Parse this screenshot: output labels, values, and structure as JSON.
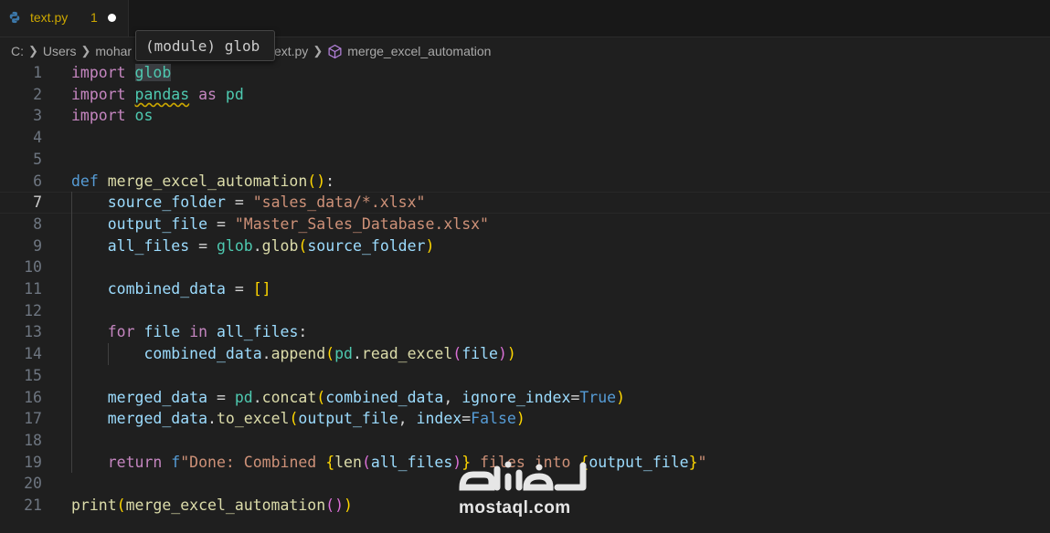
{
  "tab": {
    "filename": "text.py",
    "problem_count": "1"
  },
  "breadcrumb": {
    "drive": "C:",
    "users": "Users",
    "user": "mohar",
    "file": "text.py",
    "symbol": "merge_excel_automation"
  },
  "tooltip": {
    "text": "(module) glob"
  },
  "editor": {
    "current_line": 7
  },
  "watermark": {
    "text": "mostaql.com"
  },
  "colors": {
    "keyword": "#c586c0",
    "function": "#dcdcaa",
    "module": "#4ec9b0",
    "variable": "#9cdcfe",
    "string": "#ce9178",
    "warning": "#cca700"
  },
  "lines": [
    [
      [
        "kw",
        "import"
      ],
      [
        "txt",
        " "
      ],
      [
        "mod hl",
        "glob"
      ]
    ],
    [
      [
        "kw",
        "import"
      ],
      [
        "txt",
        " "
      ],
      [
        "mod squig",
        "pandas"
      ],
      [
        "txt",
        " "
      ],
      [
        "kw",
        "as"
      ],
      [
        "txt",
        " "
      ],
      [
        "mod",
        "pd"
      ]
    ],
    [
      [
        "kw",
        "import"
      ],
      [
        "txt",
        " "
      ],
      [
        "mod",
        "os"
      ]
    ],
    [],
    [],
    [
      [
        "def",
        "def"
      ],
      [
        "txt",
        " "
      ],
      [
        "fn",
        "merge_excel_automation"
      ],
      [
        "p1",
        "()"
      ],
      [
        "txt",
        ":"
      ]
    ],
    [
      [
        "txt",
        "    "
      ],
      [
        "var",
        "source_folder"
      ],
      [
        "txt",
        " = "
      ],
      [
        "str",
        "\"sales_data/*.xlsx\""
      ]
    ],
    [
      [
        "txt",
        "    "
      ],
      [
        "var",
        "output_file"
      ],
      [
        "txt",
        " = "
      ],
      [
        "str",
        "\"Master_Sales_Database.xlsx\""
      ]
    ],
    [
      [
        "txt",
        "    "
      ],
      [
        "var",
        "all_files"
      ],
      [
        "txt",
        " = "
      ],
      [
        "mod",
        "glob"
      ],
      [
        "txt",
        "."
      ],
      [
        "fn",
        "glob"
      ],
      [
        "p1",
        "("
      ],
      [
        "var",
        "source_folder"
      ],
      [
        "p1",
        ")"
      ]
    ],
    [],
    [
      [
        "txt",
        "    "
      ],
      [
        "var",
        "combined_data"
      ],
      [
        "txt",
        " = "
      ],
      [
        "p1",
        "[]"
      ]
    ],
    [],
    [
      [
        "txt",
        "    "
      ],
      [
        "kw",
        "for"
      ],
      [
        "txt",
        " "
      ],
      [
        "var",
        "file"
      ],
      [
        "txt",
        " "
      ],
      [
        "kw",
        "in"
      ],
      [
        "txt",
        " "
      ],
      [
        "var",
        "all_files"
      ],
      [
        "txt",
        ":"
      ]
    ],
    [
      [
        "txt",
        "        "
      ],
      [
        "var",
        "combined_data"
      ],
      [
        "txt",
        "."
      ],
      [
        "fn",
        "append"
      ],
      [
        "p1",
        "("
      ],
      [
        "mod",
        "pd"
      ],
      [
        "txt",
        "."
      ],
      [
        "fn",
        "read_excel"
      ],
      [
        "p2",
        "("
      ],
      [
        "var",
        "file"
      ],
      [
        "p2",
        ")"
      ],
      [
        "p1",
        ")"
      ]
    ],
    [],
    [
      [
        "txt",
        "    "
      ],
      [
        "var",
        "merged_data"
      ],
      [
        "txt",
        " = "
      ],
      [
        "mod",
        "pd"
      ],
      [
        "txt",
        "."
      ],
      [
        "fn",
        "concat"
      ],
      [
        "p1",
        "("
      ],
      [
        "var",
        "combined_data"
      ],
      [
        "txt",
        ", "
      ],
      [
        "var",
        "ignore_index"
      ],
      [
        "txt",
        "="
      ],
      [
        "const",
        "True"
      ],
      [
        "p1",
        ")"
      ]
    ],
    [
      [
        "txt",
        "    "
      ],
      [
        "var",
        "merged_data"
      ],
      [
        "txt",
        "."
      ],
      [
        "fn",
        "to_excel"
      ],
      [
        "p1",
        "("
      ],
      [
        "var",
        "output_file"
      ],
      [
        "txt",
        ", "
      ],
      [
        "var",
        "index"
      ],
      [
        "txt",
        "="
      ],
      [
        "const",
        "False"
      ],
      [
        "p1",
        ")"
      ]
    ],
    [],
    [
      [
        "txt",
        "    "
      ],
      [
        "kw",
        "return"
      ],
      [
        "txt",
        " "
      ],
      [
        "def",
        "f"
      ],
      [
        "str",
        "\"Done: Combined "
      ],
      [
        "p1",
        "{"
      ],
      [
        "fn",
        "len"
      ],
      [
        "p2",
        "("
      ],
      [
        "var",
        "all_files"
      ],
      [
        "p2",
        ")"
      ],
      [
        "p1",
        "}"
      ],
      [
        "str",
        " files into "
      ],
      [
        "p1",
        "{"
      ],
      [
        "var",
        "output_file"
      ],
      [
        "p1",
        "}"
      ],
      [
        "str",
        "\""
      ]
    ],
    [],
    [
      [
        "fn",
        "print"
      ],
      [
        "p1",
        "("
      ],
      [
        "fn",
        "merge_excel_automation"
      ],
      [
        "p2",
        "()"
      ],
      [
        "p1",
        ")"
      ]
    ]
  ]
}
